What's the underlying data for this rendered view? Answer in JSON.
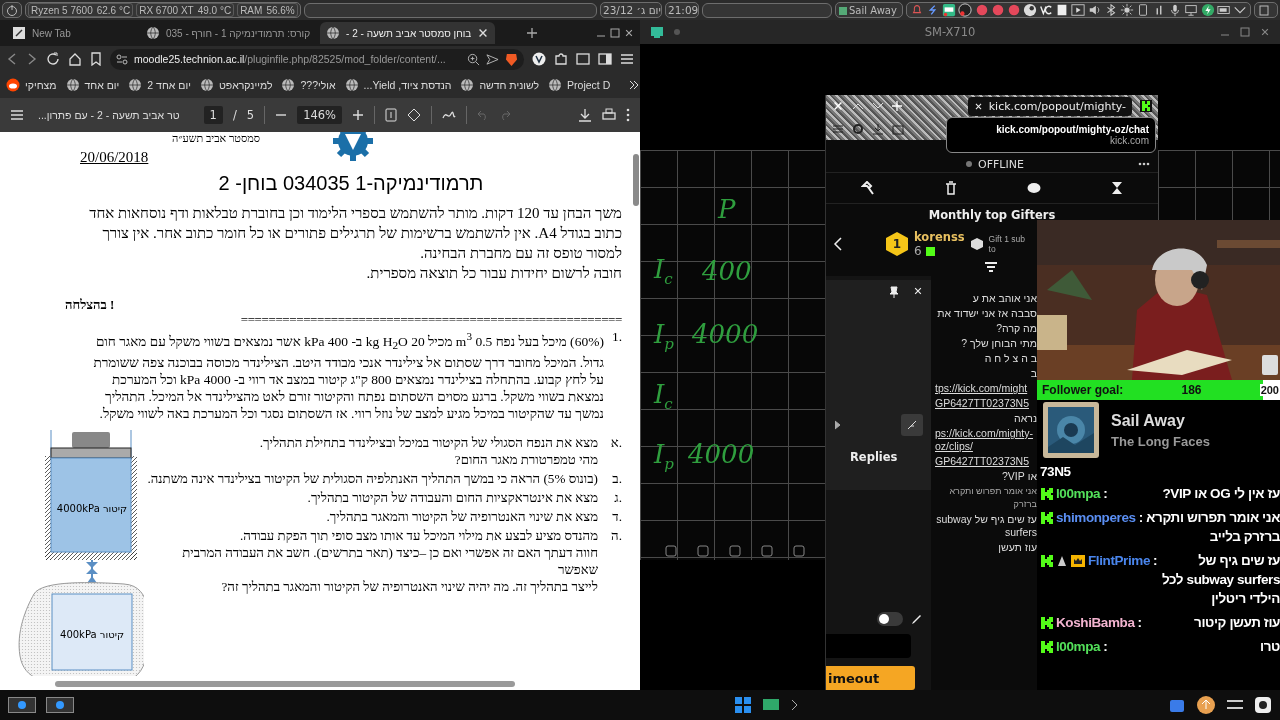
{
  "panel": {
    "monitors": [
      {
        "label": "RAM",
        "reading": "56.6%"
      },
      {
        "label": "RX 6700 XT",
        "reading": "49.0 °C"
      },
      {
        "label": "Ryzen 5 7600",
        "reading": "62.6 °C"
      }
    ],
    "date": "יום ג׳ 23/12",
    "time": "21:09",
    "task": "Sail Away"
  },
  "browser": {
    "tabs": [
      {
        "label": "בוחן סמסטר אביב תשעה - 2 -",
        "selected": true
      },
      {
        "label": "קורס: תרמודינמיקה 1 - חורף - 035",
        "selected": false
      },
      {
        "label": "New Tab",
        "selected": false
      }
    ],
    "address": {
      "host": "moodle25.technion.ac.il",
      "path": "/pluginfile.php/82525/mod_folder/content/..."
    },
    "bookmarks": [
      "Project D",
      "לשונית חדשה",
      "הנדסת ציוד, Yield...",
      "אולי???",
      "למיינקראפט",
      "יום אחד 2",
      "יום אחד",
      "מצחיקי"
    ]
  },
  "pdf_viewer": {
    "title": "...טר אביב תשעה - 2 - עם פתרון",
    "page": "1",
    "page_separator": "/",
    "page_count": "5",
    "zoom": "146%",
    "undo": {
      "disabled": true
    },
    "redo": {
      "disabled": true
    }
  },
  "document": {
    "semester": "סמסטר אביב תשע״ה",
    "date": "20/06/2018",
    "title": "תרמודינמיקה-1 034035 בוחן- 2",
    "instructions": [
      "משך הבחן עד 120 דקות. מותר להשתמש בספרי הלימוד וכן בחוברת טבלאות ודף נוסחאות אחד כתוב בגודל A4. אין להשתמש ברשימות של תרגילים פתורים או כל חומר כתוב אחר. אין צורך למסור טופס זה עם מחברת הבחינה.",
      "חובה לרשום יחידות עבור כל תוצאה מספרית."
    ],
    "good_luck": "בהצלחה !",
    "divider": "=======================================================",
    "question": {
      "number": "1.",
      "text": "(60%) מיכל בעל נפח 0.5 m$^{3}$ מכיל 20 kg H$_{2}$O ב- 400 kPa אשר נמצאים בשווי משקל עם מאגר חום גדול. המיכל מחובר דרך שסתום אל צילינדר אנכי מבודד היטב. הצילינדר מכוסה בבוכנה צפה ששומרת על לחץ קבוע. בהתחלה בצילינדר נמצאים 800 ק\"ג קיטור במצב אד רווי ב- 4000 kPa וכל המערכת נמצאת בשווי משקל. ברגע מסוים השסתום נפתח והקיטור זורם לאט מהצילינדר אל המיכל. התהליך נמשך עד שהקיטור במיכל מגיע למצב של נוזל רווי. אז השסתום נסגר וכל המערכת באה לשווי משקל.",
      "parts": [
        {
          "letter": "א.",
          "lines": [
            "מצא את הנפח הסגולי של הקיטור במיכל ובצילינדר בתחילת התהליך.",
            "מהי טמפרטורת מאגר החום?"
          ]
        },
        {
          "letter": "ב.",
          "lines": [
            "(בונוס 5%) הראה כי במשך התהליך האנתלפיה הסגולית של הקיטור בצילינדר אינה משתנה."
          ]
        },
        {
          "letter": "ג.",
          "lines": [
            "מצא את אינטראקציות החום והעבודה של הקיטור בתהליך."
          ]
        },
        {
          "letter": "ד.",
          "lines": [
            "מצא את שינוי האנטרופיה של הקיטור והמאגר בתהליך."
          ]
        },
        {
          "letter": "ה.",
          "lines": [
            "מהנדס מציע לבצע את מילוי המיכל עד אותו מצב סופי תוך הפקת עבודה.",
            "חווה דעתך האם זה אפשרי ואם כן –כיצד (תאר בתרשים). חשב את העבודה המרבית שאפשר",
            "לייצר בתהליך זה. מה יהיה שינוי האנטרופיה של הקיטור והמאגר בתהליך זה?"
          ]
        }
      ],
      "diagram_labels": [
        "קיטור 4000kPa",
        "קיטור 400kPa"
      ]
    }
  },
  "tablet": {
    "title": "SM-X710",
    "notes": [
      {
        "label": "P"
      },
      {
        "label": "I$_{c}$",
        "value": "400"
      },
      {
        "label": "I$_{p}$",
        "value": "4000"
      },
      {
        "label": "I$_{c}$"
      },
      {
        "label": "I$_{p}$",
        "value": "4000"
      }
    ]
  },
  "kick_window": {
    "tab": "kick.com/popout/mighty-",
    "tooltip": {
      "title": "kick.com/popout/mighty-oz/chat",
      "host": "kick.com"
    },
    "status": "OFFLINE",
    "gifters_title": "Monthly top Gifters",
    "top_gifter": {
      "rank": "1",
      "name": "korenss",
      "count": "6"
    },
    "notice": "Gift 1 sub to",
    "replies_label": "Replies",
    "toggle_on": false,
    "timeout_button": "imeout",
    "chat_lines": [
      {
        "kind": "text",
        "text": "אני אוהב את ע"
      },
      {
        "kind": "text",
        "text": "סבבה אז אני ישדוד את"
      },
      {
        "kind": "text",
        "text": "מה קרה?"
      },
      {
        "kind": "text",
        "text": "מתי הבוחן שלך ?"
      },
      {
        "kind": "text",
        "text": "ב ה צ ל ח ה"
      },
      {
        "kind": "text",
        "text": "ב"
      },
      {
        "kind": "link",
        "text": "tps://kick.com/might"
      },
      {
        "kind": "link",
        "text": "GP6427TT02373N5"
      },
      {
        "kind": "text",
        "text": "נראה"
      },
      {
        "kind": "link",
        "text": "ps://kick.com/mighty-oz/clips/"
      },
      {
        "kind": "link",
        "text": "GP6427TT02373N5"
      },
      {
        "kind": "text",
        "text": "או VIP?"
      },
      {
        "kind": "small",
        "text": "אני אומר תפרוש ותקרא ברזרק"
      },
      {
        "kind": "text",
        "text": "עז שים גיף של subway surfers"
      },
      {
        "kind": "text",
        "text": "עוז תעשן"
      }
    ]
  },
  "overlay": {
    "follower_goal": {
      "label": "Follower goal:",
      "current": "186",
      "target": "200",
      "level": 0.93
    },
    "now_playing": {
      "title": "Sail Away",
      "artist": "The Long Faces"
    },
    "chat": {
      "continuation": "73N5",
      "separator": ":",
      "messages": [
        {
          "user": "l00mpa",
          "color": "#53e05a",
          "badges": [
            {
              "kind": "kick"
            }
          ],
          "text": "עז אין לי OG או VIP?"
        },
        {
          "user": "shimonperes",
          "color": "#5a8ef2",
          "badges": [
            {
              "kind": "kick"
            }
          ],
          "text": "אני אומר תפרוש ותקרא ברזרק בלייב"
        },
        {
          "user": "FlintPrime",
          "color": "#4a86ee",
          "badges": [
            {
              "kind": "kick"
            },
            {
              "kind": "mod"
            },
            {
              "kind": "crown"
            }
          ],
          "text": "עז שים גיף של subway surfers לכל הילדי ריטלין"
        },
        {
          "user": "KoshiBamba",
          "color": "#f2b3cf",
          "badges": [
            {
              "kind": "kick"
            }
          ],
          "text": "עוז תעשן קיטור"
        },
        {
          "user": "l00mpa",
          "color": "#53e05a",
          "badges": [
            {
              "kind": "kick"
            }
          ],
          "text": "טרו"
        }
      ]
    }
  }
}
